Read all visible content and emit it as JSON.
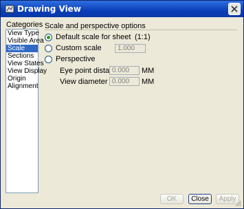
{
  "window": {
    "title": "Drawing View"
  },
  "categories": {
    "label": "Categories",
    "items": [
      {
        "label": "View Type",
        "selected": false
      },
      {
        "label": "Visible Area",
        "selected": false
      },
      {
        "label": "Scale",
        "selected": true
      },
      {
        "label": "Sections",
        "selected": false
      },
      {
        "label": "View States",
        "selected": false
      },
      {
        "label": "View Display",
        "selected": false
      },
      {
        "label": "Origin",
        "selected": false
      },
      {
        "label": "Alignment",
        "selected": false
      }
    ]
  },
  "scale": {
    "group_label": "Scale and perspective options",
    "default_scale": {
      "label": "Default scale for sheet",
      "value": "(1:1)",
      "checked": true
    },
    "custom_scale": {
      "label": "Custom scale",
      "value": "1.000",
      "checked": false
    },
    "perspective": {
      "label": "Perspective",
      "checked": false,
      "eye_point_label": "Eye point distance",
      "eye_point_value": "0.000",
      "eye_point_unit": "MM",
      "view_diameter_label": "View diameter",
      "view_diameter_value": "0.000",
      "view_diameter_unit": "MM"
    }
  },
  "buttons": {
    "ok": "OK",
    "close": "Close",
    "apply": "Apply"
  }
}
